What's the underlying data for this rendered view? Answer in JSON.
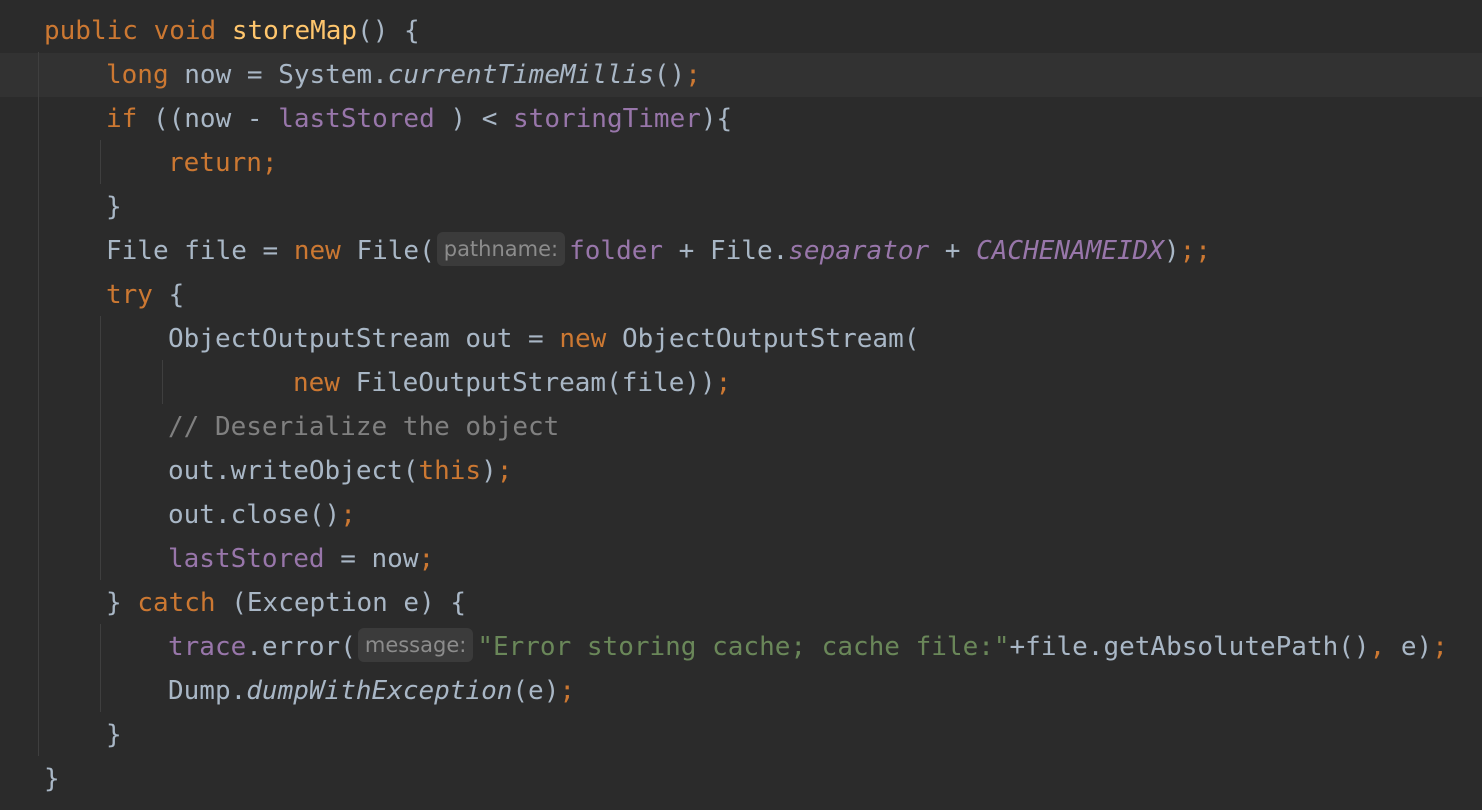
{
  "editor": {
    "language": "Java",
    "colors": {
      "background": "#2b2b2b",
      "current_line": "#323232",
      "default_text": "#a9b7c6",
      "keyword": "#cc7832",
      "method_declaration": "#ffc66d",
      "field": "#9876aa",
      "string": "#6a8759",
      "comment": "#808080",
      "inlay_hint_text": "#8c8c8c",
      "inlay_hint_background": "#3b3b3b"
    },
    "current_line_index": 1,
    "inlay_hints": {
      "pathname": "pathname:",
      "message": "message:"
    },
    "lines": [
      [
        {
          "t": "public",
          "k": "kw"
        },
        {
          "t": " "
        },
        {
          "t": "void",
          "k": "kw"
        },
        {
          "t": " "
        },
        {
          "t": "storeMap",
          "k": "fn"
        },
        {
          "t": "() {"
        }
      ],
      [
        {
          "t": "long",
          "k": "kw"
        },
        {
          "t": " now = System."
        },
        {
          "t": "currentTimeMillis",
          "k": "itm"
        },
        {
          "t": "()"
        },
        {
          "t": ";",
          "k": "kw"
        }
      ],
      [
        {
          "t": "if",
          "k": "kw"
        },
        {
          "t": " ((now - "
        },
        {
          "t": "lastStored",
          "k": "fld"
        },
        {
          "t": " ) < "
        },
        {
          "t": "storingTimer",
          "k": "fld"
        },
        {
          "t": "){"
        }
      ],
      [
        {
          "t": "return",
          "k": "kw"
        },
        {
          "t": ";",
          "k": "kw"
        }
      ],
      [
        {
          "t": "}"
        }
      ],
      [
        {
          "t": "File file = "
        },
        {
          "t": "new",
          "k": "kw"
        },
        {
          "t": " File("
        },
        {
          "hint": "pathname"
        },
        {
          "t": "folder",
          "k": "fld"
        },
        {
          "t": " + File."
        },
        {
          "t": "separator",
          "k": "st"
        },
        {
          "t": " + "
        },
        {
          "t": "CACHENAMEIDX",
          "k": "st"
        },
        {
          "t": ")"
        },
        {
          "t": ";;",
          "k": "kw"
        }
      ],
      [
        {
          "t": "try",
          "k": "kw"
        },
        {
          "t": " {"
        }
      ],
      [
        {
          "t": "ObjectOutputStream out = "
        },
        {
          "t": "new",
          "k": "kw"
        },
        {
          "t": " ObjectOutputStream("
        }
      ],
      [
        {
          "t": "new",
          "k": "kw"
        },
        {
          "t": " FileOutputStream(file))"
        },
        {
          "t": ";",
          "k": "kw"
        }
      ],
      [
        {
          "t": "// Deserialize the object",
          "k": "cmt"
        }
      ],
      [
        {
          "t": "out.writeObject("
        },
        {
          "t": "this",
          "k": "kw"
        },
        {
          "t": ")"
        },
        {
          "t": ";",
          "k": "kw"
        }
      ],
      [
        {
          "t": "out.close()"
        },
        {
          "t": ";",
          "k": "kw"
        }
      ],
      [
        {
          "t": "lastStored",
          "k": "fld"
        },
        {
          "t": " = now"
        },
        {
          "t": ";",
          "k": "kw"
        }
      ],
      [
        {
          "t": "} "
        },
        {
          "t": "catch",
          "k": "kw"
        },
        {
          "t": " (Exception e) {"
        }
      ],
      [
        {
          "t": "trace",
          "k": "fld"
        },
        {
          "t": ".error("
        },
        {
          "hint": "message"
        },
        {
          "t": "\"Error storing cache; cache file:\"",
          "k": "str"
        },
        {
          "t": "+file.getAbsolutePath()"
        },
        {
          "t": ",",
          "k": "kw"
        },
        {
          "t": " e)"
        },
        {
          "t": ";",
          "k": "kw"
        }
      ],
      [
        {
          "t": "Dump."
        },
        {
          "t": "dumpWithException",
          "k": "itm"
        },
        {
          "t": "(e)"
        },
        {
          "t": ";",
          "k": "kw"
        }
      ],
      [
        {
          "t": "}"
        }
      ],
      [
        {
          "t": "}"
        }
      ]
    ]
  }
}
